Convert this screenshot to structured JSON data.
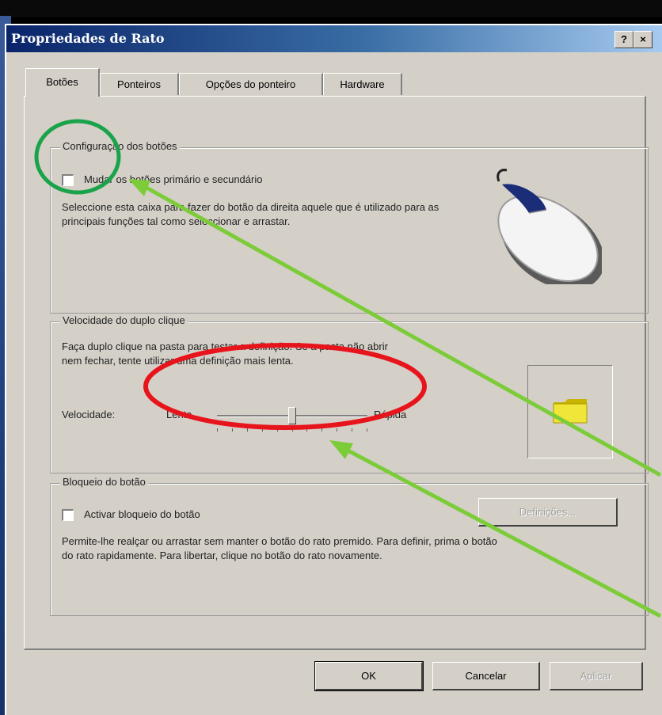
{
  "window": {
    "title": "Propriedades de Rato",
    "help_label": "?",
    "close_label": "×"
  },
  "tabs": [
    {
      "label": "Botões",
      "active": true
    },
    {
      "label": "Ponteiros",
      "active": false
    },
    {
      "label": "Opções do ponteiro",
      "active": false
    },
    {
      "label": "Hardware",
      "active": false
    }
  ],
  "button_config": {
    "group_label": "Configuração dos botões",
    "switch_label": "Mudar os botões primário e secundário",
    "switch_checked": false,
    "description": "Seleccione esta caixa para fazer do botão da direita aquele que é utilizado para as principais funções tal como seleccionar e arrastar."
  },
  "double_click": {
    "group_label": "Velocidade do duplo clique",
    "description": "Faça duplo clique na pasta para testar a definição. Se a pasta não abrir nem fechar, tente utilizar uma definição mais lenta.",
    "speed_label": "Velocidade:",
    "slow_label": "Lenta",
    "fast_label": "Rápida",
    "speed_value": 0.5,
    "tick_count": 11
  },
  "clicklock": {
    "group_label": "Bloqueio do botão",
    "checkbox_label": "Activar bloqueio do botão",
    "checked": false,
    "settings_label": "Definições...",
    "description": "Permite-lhe realçar ou arrastar sem manter o botão do rato premido. Para definir, prima o botão do rato rapidamente. Para libertar, clique no botão do rato novamente."
  },
  "footer": {
    "ok_label": "OK",
    "cancel_label": "Cancelar",
    "apply_label": "Aplicar"
  },
  "annotations": {
    "circle_color": "#1aa34a",
    "ellipse_color": "#e8141c",
    "arrow_color": "#7ccc3a"
  }
}
